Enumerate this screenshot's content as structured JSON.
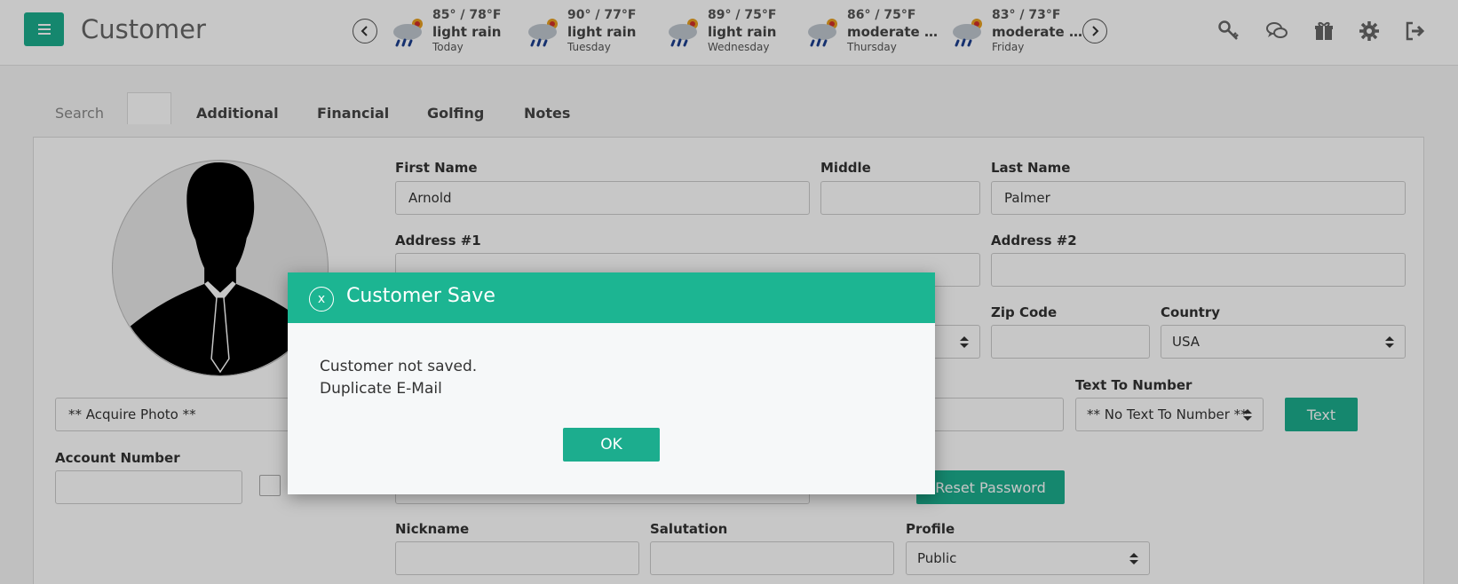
{
  "header": {
    "title": "Customer",
    "menu_icon": "hamburger-menu-icon"
  },
  "weather": {
    "days": [
      {
        "temp": "85° / 78°F",
        "condition": "light rain",
        "day": "Today"
      },
      {
        "temp": "90° / 77°F",
        "condition": "light rain",
        "day": "Tuesday"
      },
      {
        "temp": "89° / 75°F",
        "condition": "light rain",
        "day": "Wednesday"
      },
      {
        "temp": "86° / 75°F",
        "condition": "moderate rain",
        "day": "Thursday"
      },
      {
        "temp": "83° / 73°F",
        "condition": "moderate rain",
        "day": "Friday"
      }
    ]
  },
  "tabs": {
    "search": "Search",
    "additional": "Additional",
    "financial": "Financial",
    "golfing": "Golfing",
    "notes": "Notes"
  },
  "form": {
    "first_name_label": "First Name",
    "first_name_value": "Arnold",
    "middle_label": "Middle",
    "middle_value": "",
    "last_name_label": "Last Name",
    "last_name_value": "Palmer",
    "address1_label": "Address #1",
    "address1_value": "",
    "address2_label": "Address #2",
    "address2_value": "",
    "zip_label": "Zip Code",
    "zip_value": "",
    "country_label": "Country",
    "country_value": "USA",
    "text_to_number_label": "Text To Number",
    "text_to_number_value": "** No Text To Number **",
    "text_button": "Text",
    "acquire_photo_value": "** Acquire Photo **",
    "account_number_label": "Account Number",
    "account_number_value": "",
    "reset_password_button": "Reset Password",
    "nickname_label": "Nickname",
    "nickname_value": "",
    "salutation_label": "Salutation",
    "salutation_value": "",
    "profile_label": "Profile",
    "profile_value": "Public"
  },
  "modal": {
    "close_label": "x",
    "title": "Customer Save",
    "message_line1": "Customer not saved.",
    "message_line2": "Duplicate E-Mail",
    "ok_button": "OK"
  },
  "colors": {
    "accent": "#1cad8e",
    "modal_header": "#1cb592"
  }
}
